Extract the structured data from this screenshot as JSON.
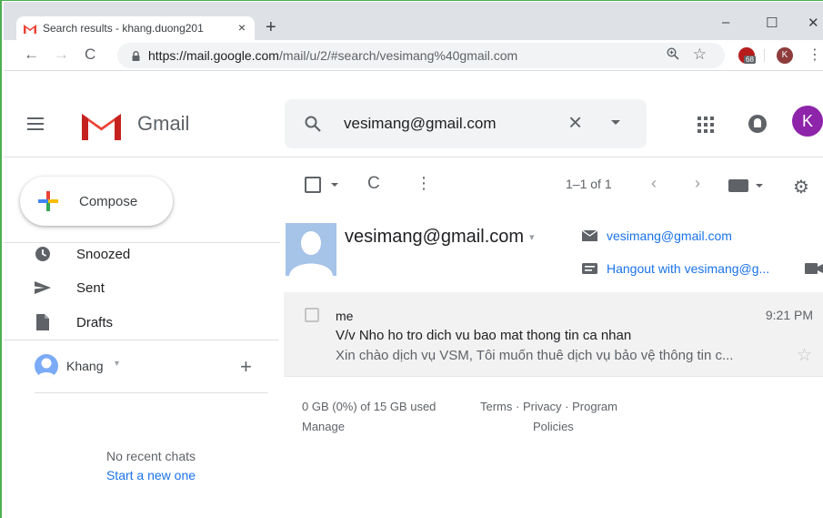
{
  "browser": {
    "tab_title": "Search results - khang.duong201",
    "tab_close": "×",
    "new_tab": "+",
    "minimize": "–",
    "maximize": "☐",
    "close": "✕",
    "back": "←",
    "forward": "→",
    "reload": "C",
    "url_host": "https://mail.google.com",
    "url_path": "/mail/u/2/#search/vesimang%40gmail.com",
    "extension_badge": "68",
    "profile_initial": "K",
    "menu_glyph": "⋮"
  },
  "gmail": {
    "logo_text": "Gmail",
    "search_value": "vesimang@gmail.com",
    "search_clear": "×",
    "account_initial": "K"
  },
  "sidebar": {
    "compose_label": "Compose",
    "items": [
      {
        "label": "Snoozed",
        "icon": "clock-icon"
      },
      {
        "label": "Sent",
        "icon": "send-icon"
      },
      {
        "label": "Drafts",
        "icon": "draft-icon"
      }
    ],
    "hangouts_user": "Khang",
    "hangouts_caret": "▾",
    "hangouts_add": "+",
    "no_recent": "No recent chats",
    "start_new": "Start a new one"
  },
  "toolbar": {
    "refresh_glyph": "C",
    "more_glyph": "⋮",
    "count": "1–1 of 1",
    "prev": "‹",
    "next": "›",
    "settings_glyph": "⚙"
  },
  "contact": {
    "email_header": "vesimang@gmail.com",
    "caret": "▾",
    "email_link": "vesimang@gmail.com",
    "hangout_link": "Hangout with vesimang@g..."
  },
  "email": {
    "from": "me",
    "time": "9:21 PM",
    "subject": "V/v Nho ho tro dich vu bao mat thong tin ca nhan",
    "snippet": "Xin chào dịch vụ VSM, Tôi muốn thuê dịch vụ bảo vệ thông tin c...",
    "star": "☆"
  },
  "footer": {
    "storage": "0 GB (0%) of 15 GB used",
    "manage": "Manage",
    "links": "Terms · Privacy · Program",
    "policies": "Policies"
  },
  "colors": {
    "accent_blue": "#1a73e8",
    "gmail_red": "#ea4335",
    "avatar_purple": "#8e24aa"
  }
}
